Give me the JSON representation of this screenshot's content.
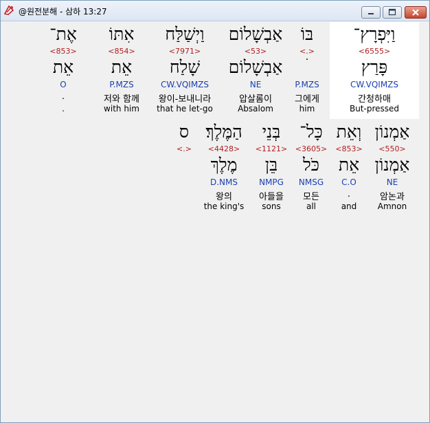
{
  "window": {
    "title": "@원전분해 - 삼하 13:27"
  },
  "rows": [
    {
      "words": [
        {
          "heb": "וַיִּפְרָץ־",
          "strong": "<6555>",
          "lemma": "פָּרַץ",
          "parse": "CW.VQIMZS",
          "kor": "간청하매",
          "eng": "But-pressed"
        },
        {
          "heb": "בּוֹ",
          "strong": "<.>",
          "lemma": "ׄ",
          "parse": "P.MZS",
          "kor": "그에게",
          "eng": "him"
        },
        {
          "heb": "אַבְשָׁלוֹם",
          "strong": "<53>",
          "lemma": "אַבְשָׁלוֹם",
          "parse": "NE",
          "kor": "압살롬이",
          "eng": "Absalom"
        },
        {
          "heb": "וַיְשַׁלַּח",
          "strong": "<7971>",
          "lemma": "שָׁלַח",
          "parse": "CW.VQIMZS",
          "kor": "왕이-보내니라",
          "eng": "that he let-go"
        },
        {
          "heb": "אִתּוֹ",
          "strong": "<854>",
          "lemma": "אֵת",
          "parse": "P.MZS",
          "kor": "저와 함께",
          "eng": "with him"
        },
        {
          "heb": "אֶת־",
          "strong": "<853>",
          "lemma": "אֵת",
          "parse": "O",
          "kor": ".",
          "eng": "."
        }
      ]
    },
    {
      "words": [
        {
          "heb": "אַמְנוֹן",
          "strong": "<550>",
          "lemma": "אַמְנוֹן",
          "parse": "NE",
          "kor": "암논과",
          "eng": "Amnon"
        },
        {
          "heb": "וְאֵת",
          "strong": "<853>",
          "lemma": "אֵת",
          "parse": "C.O",
          "kor": ".",
          "eng": "and"
        },
        {
          "heb": "כָּל־",
          "strong": "<3605>",
          "lemma": "כֹּל",
          "parse": "NMSG",
          "kor": "모든",
          "eng": "all"
        },
        {
          "heb": "בְּנֵי",
          "strong": "<1121>",
          "lemma": "בֵּן",
          "parse": "NMPG",
          "kor": "아들을",
          "eng": "sons"
        },
        {
          "heb": "הַמֶּלֶךְ׃",
          "strong": "<4428>",
          "lemma": "מֶלֶךְ",
          "parse": "D.NMS",
          "kor": "왕의",
          "eng": "the king's"
        },
        {
          "heb": "ס",
          "strong": "<.>",
          "lemma": "",
          "parse": "",
          "kor": "",
          "eng": ""
        }
      ]
    }
  ]
}
